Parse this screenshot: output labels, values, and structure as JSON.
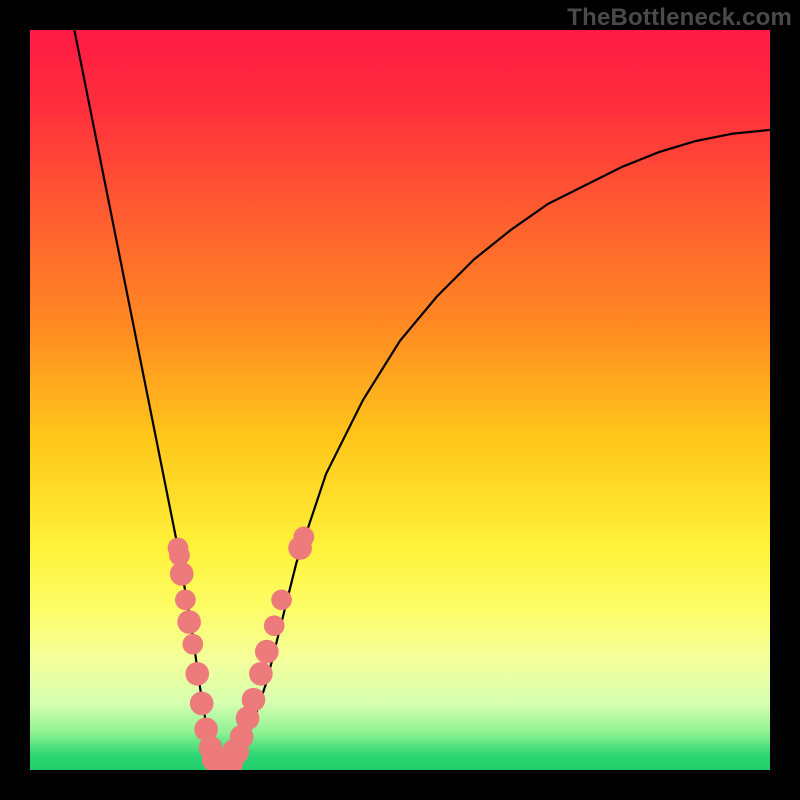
{
  "watermark": "TheBottleneck.com",
  "gradient": {
    "stops": [
      {
        "offset": 0.0,
        "color": "#ff1a44"
      },
      {
        "offset": 0.1,
        "color": "#ff2d3d"
      },
      {
        "offset": 0.25,
        "color": "#ff5d30"
      },
      {
        "offset": 0.4,
        "color": "#ff8a22"
      },
      {
        "offset": 0.55,
        "color": "#ffc61a"
      },
      {
        "offset": 0.7,
        "color": "#fff23a"
      },
      {
        "offset": 0.78,
        "color": "#fdfd66"
      },
      {
        "offset": 0.85,
        "color": "#f4ff9a"
      },
      {
        "offset": 0.91,
        "color": "#d6ffb0"
      },
      {
        "offset": 0.95,
        "color": "#8cf292"
      },
      {
        "offset": 0.98,
        "color": "#2ed673"
      },
      {
        "offset": 1.0,
        "color": "#1ecf6a"
      }
    ]
  },
  "chart_data": {
    "type": "line",
    "title": "",
    "xlabel": "",
    "ylabel": "",
    "xlim": [
      0,
      100
    ],
    "ylim": [
      0,
      100
    ],
    "series": [
      {
        "name": "bottleneck-curve",
        "x": [
          6.0,
          8.0,
          10.0,
          12.0,
          14.0,
          16.0,
          18.0,
          20.0,
          22.0,
          23.0,
          24.0,
          25.0,
          26.0,
          27.0,
          28.0,
          30.0,
          32.0,
          34.0,
          36.0,
          40.0,
          45.0,
          50.0,
          55.0,
          60.0,
          65.0,
          70.0,
          75.0,
          80.0,
          85.0,
          90.0,
          95.0,
          100.0
        ],
        "values": [
          100.0,
          90.0,
          80.0,
          70.0,
          60.0,
          50.0,
          40.0,
          30.0,
          18.0,
          11.0,
          5.0,
          1.5,
          0.5,
          0.5,
          1.5,
          6.0,
          12.0,
          20.0,
          28.0,
          40.0,
          50.0,
          58.0,
          64.0,
          69.0,
          73.0,
          76.5,
          79.0,
          81.5,
          83.5,
          85.0,
          86.0,
          86.5
        ]
      }
    ],
    "markers": [
      {
        "x": 20.0,
        "y": 30.0,
        "r": 1.4
      },
      {
        "x": 20.2,
        "y": 29.0,
        "r": 1.4
      },
      {
        "x": 20.5,
        "y": 26.5,
        "r": 1.6
      },
      {
        "x": 21.0,
        "y": 23.0,
        "r": 1.4
      },
      {
        "x": 21.5,
        "y": 20.0,
        "r": 1.6
      },
      {
        "x": 22.0,
        "y": 17.0,
        "r": 1.4
      },
      {
        "x": 22.6,
        "y": 13.0,
        "r": 1.6
      },
      {
        "x": 23.2,
        "y": 9.0,
        "r": 1.6
      },
      {
        "x": 23.8,
        "y": 5.5,
        "r": 1.6
      },
      {
        "x": 24.4,
        "y": 3.0,
        "r": 1.6
      },
      {
        "x": 25.0,
        "y": 1.5,
        "r": 1.8
      },
      {
        "x": 25.7,
        "y": 0.7,
        "r": 1.8
      },
      {
        "x": 26.4,
        "y": 0.6,
        "r": 1.8
      },
      {
        "x": 27.0,
        "y": 1.0,
        "r": 1.8
      },
      {
        "x": 27.8,
        "y": 2.5,
        "r": 1.8
      },
      {
        "x": 28.6,
        "y": 4.5,
        "r": 1.6
      },
      {
        "x": 29.4,
        "y": 7.0,
        "r": 1.6
      },
      {
        "x": 30.2,
        "y": 9.5,
        "r": 1.6
      },
      {
        "x": 31.2,
        "y": 13.0,
        "r": 1.6
      },
      {
        "x": 32.0,
        "y": 16.0,
        "r": 1.6
      },
      {
        "x": 33.0,
        "y": 19.5,
        "r": 1.4
      },
      {
        "x": 34.0,
        "y": 23.0,
        "r": 1.4
      },
      {
        "x": 36.5,
        "y": 30.0,
        "r": 1.6
      },
      {
        "x": 37.0,
        "y": 31.5,
        "r": 1.4
      }
    ],
    "curve_color": "#000000",
    "marker_color": "#ed7b7b"
  }
}
